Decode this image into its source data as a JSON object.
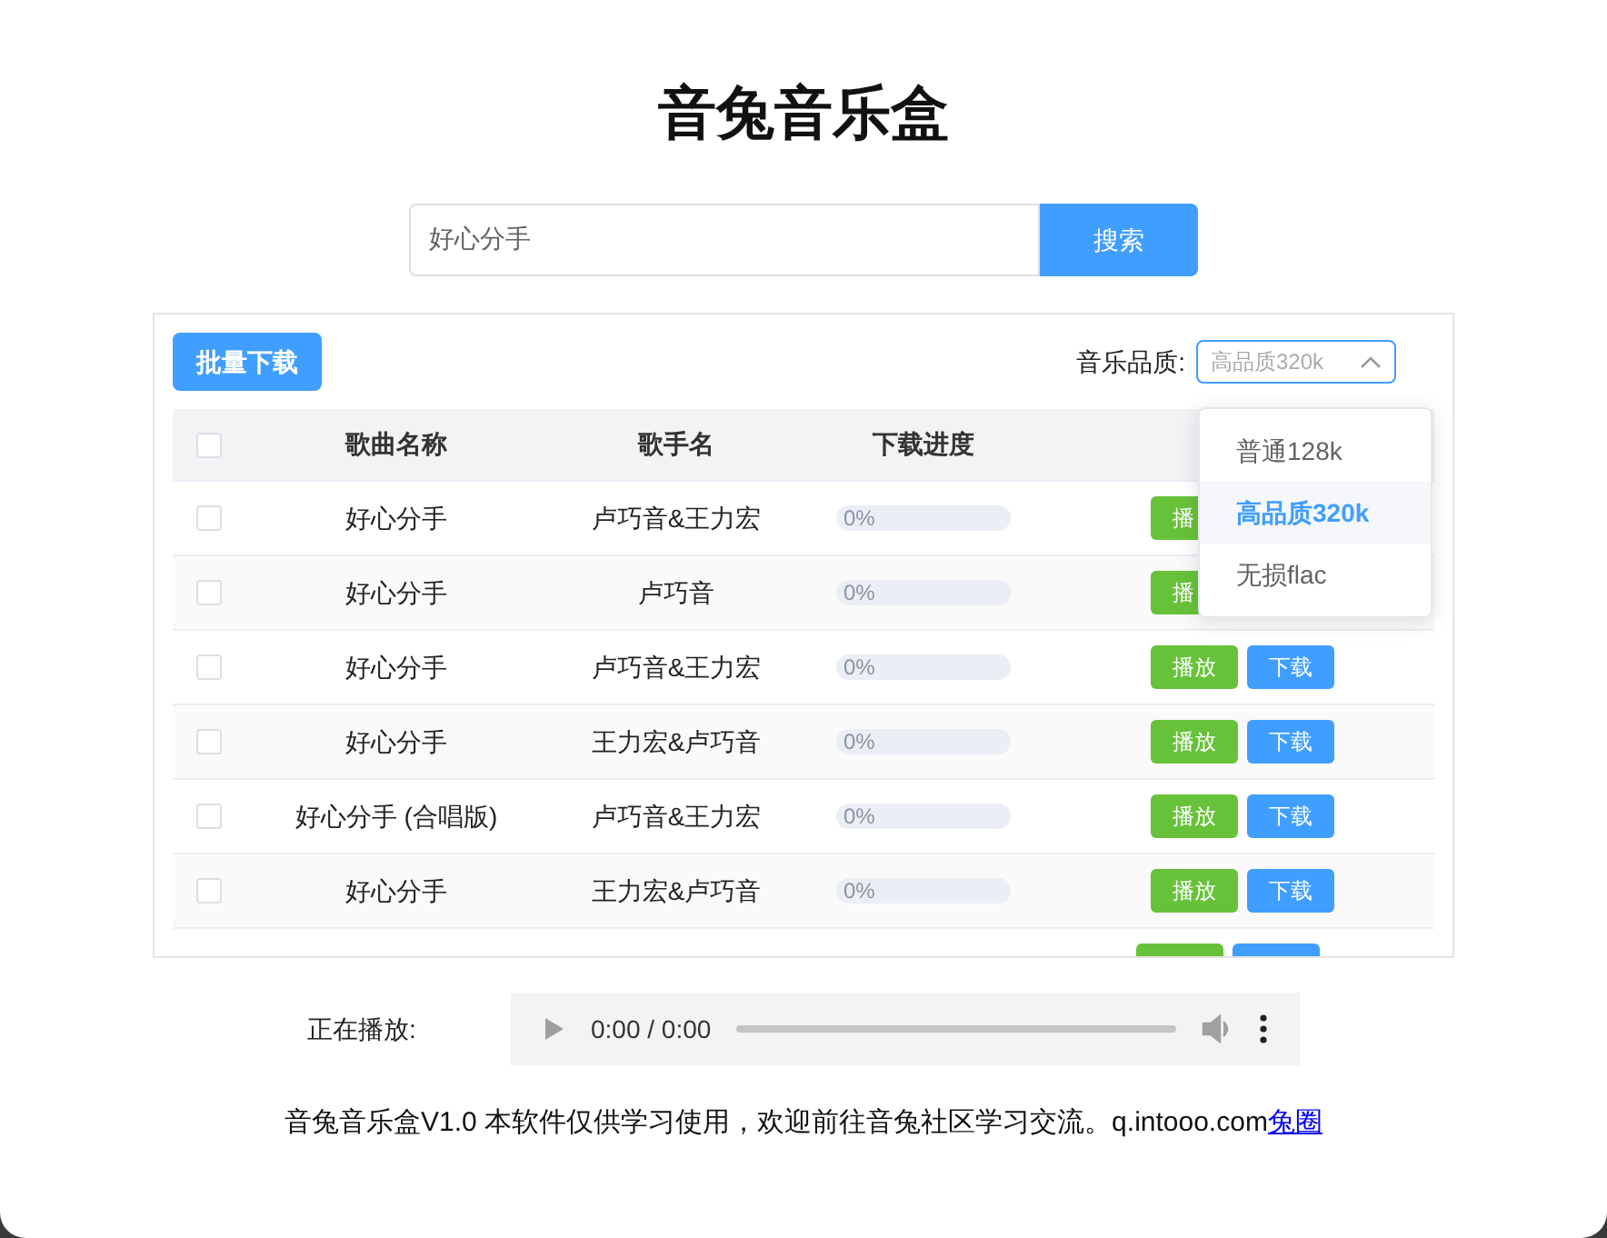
{
  "title": "音兔音乐盒",
  "search": {
    "value": "好心分手",
    "button": "搜索"
  },
  "toolbar": {
    "batch_button": "批量下载",
    "quality_label": "音乐品质:",
    "quality_value": "高品质320k",
    "dropdown_open": true
  },
  "quality_options": [
    {
      "label": "普通128k",
      "selected": false
    },
    {
      "label": "高品质320k",
      "selected": true
    },
    {
      "label": "无损flac",
      "selected": false
    }
  ],
  "table": {
    "columns": [
      "歌曲名称",
      "歌手名",
      "下载进度"
    ],
    "all_checked": false,
    "rows": [
      {
        "checked": false,
        "song": "好心分手",
        "singer": "卢巧音&王力宏",
        "progress": "0%",
        "level": 0,
        "play": "播"
      },
      {
        "checked": false,
        "song": "好心分手",
        "singer": "卢巧音",
        "progress": "0%",
        "level": 0,
        "play": "播"
      },
      {
        "checked": false,
        "song": "好心分手",
        "singer": "卢巧音&王力宏",
        "progress": "0%",
        "level": 0,
        "play": "播放",
        "download": "下载"
      },
      {
        "checked": false,
        "song": "好心分手",
        "singer": "王力宏&卢巧音",
        "progress": "0%",
        "level": 0,
        "play": "播放",
        "download": "下载"
      },
      {
        "checked": false,
        "song": "好心分手 (合唱版)",
        "singer": "卢巧音&王力宏",
        "progress": "0%",
        "level": 0,
        "play": "播放",
        "download": "下载"
      },
      {
        "checked": false,
        "song": "好心分手",
        "singer": "王力宏&卢巧音",
        "progress": "0%",
        "level": 0,
        "play": "播放",
        "download": "下载"
      }
    ]
  },
  "player": {
    "label": "正在播放:",
    "time": "0:00 / 0:00"
  },
  "footer": {
    "text": "音兔音乐盒V1.0 本软件仅供学习使用，欢迎前往音兔社区学习交流。q.intooo.com",
    "link": "兔圈"
  }
}
